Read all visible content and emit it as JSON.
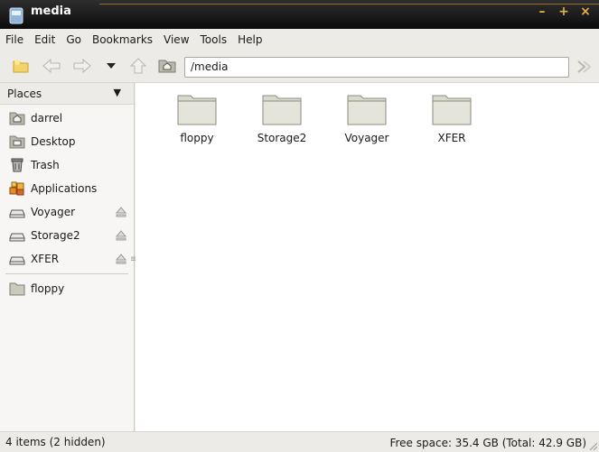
{
  "window": {
    "title": "media",
    "controls": [
      "–",
      "+",
      "×"
    ]
  },
  "menubar": {
    "items": [
      {
        "label": "File"
      },
      {
        "label": "Edit"
      },
      {
        "label": "Go"
      },
      {
        "label": "Bookmarks"
      },
      {
        "label": "View"
      },
      {
        "label": "Tools"
      },
      {
        "label": "Help"
      }
    ]
  },
  "toolbar": {
    "location": "/media"
  },
  "sidebar": {
    "header": "Places",
    "items": [
      {
        "label": "darrel",
        "icon": "home-folder-icon"
      },
      {
        "label": "Desktop",
        "icon": "desktop-folder-icon"
      },
      {
        "label": "Trash",
        "icon": "trash-icon"
      },
      {
        "label": "Applications",
        "icon": "applications-icon"
      },
      {
        "label": "Voyager",
        "icon": "drive-icon"
      },
      {
        "label": "Storage2",
        "icon": "drive-icon"
      },
      {
        "label": "XFER",
        "icon": "drive-icon"
      }
    ],
    "bookmarks": [
      {
        "label": "floppy",
        "icon": "folder-icon"
      }
    ]
  },
  "files": [
    {
      "name": "floppy"
    },
    {
      "name": "Storage2"
    },
    {
      "name": "Voyager"
    },
    {
      "name": "XFER"
    }
  ],
  "status": {
    "left": "4 items (2 hidden)",
    "right": "Free space: 35.4 GB (Total: 42.9 GB)"
  },
  "colors": {
    "titlebar": "#111111",
    "accent": "#e9b04a",
    "folder": "#dcdcd0"
  }
}
